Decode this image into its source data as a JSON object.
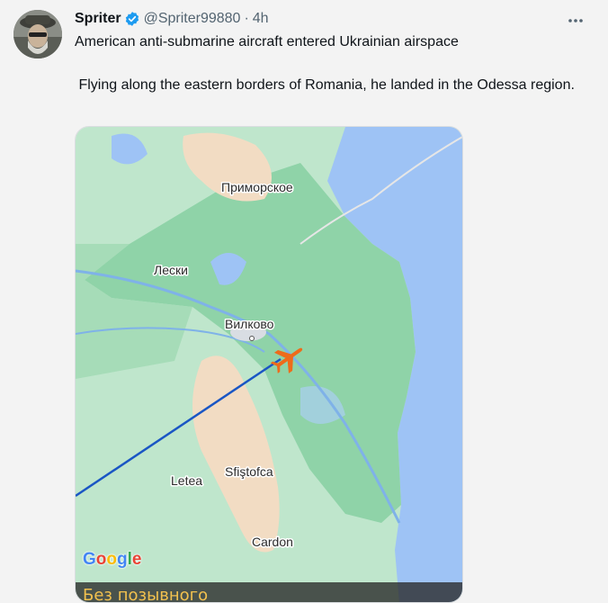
{
  "tweet": {
    "author_name": "Spriter",
    "handle": "@Spriter99880",
    "separator": "·",
    "time": "4h",
    "text_line1": "American anti-submarine aircraft entered Ukrainian airspace",
    "text_line2": " Flying along the eastern borders of Romania, he landed in the Odessa region."
  },
  "map": {
    "labels": {
      "primorskoe": "Приморское",
      "leski": "Лески",
      "vilkovo": "Вилково",
      "letea": "Letea",
      "sfistofca": "Sfiştofca",
      "cardon": "Cardon"
    },
    "google_logo": "Google",
    "caption": "Без позывного"
  },
  "colors": {
    "accent_blue": "#1d9bf0",
    "land_green": "#8fd3a8",
    "water_blue": "#9ec3f5",
    "sand": "#f2dcc3",
    "plane_orange": "#ee6b1a",
    "flight_path": "#1a56c4"
  },
  "icons": {
    "verified": "verified-badge-icon",
    "more": "more-options-icon",
    "plane": "airplane-icon"
  }
}
